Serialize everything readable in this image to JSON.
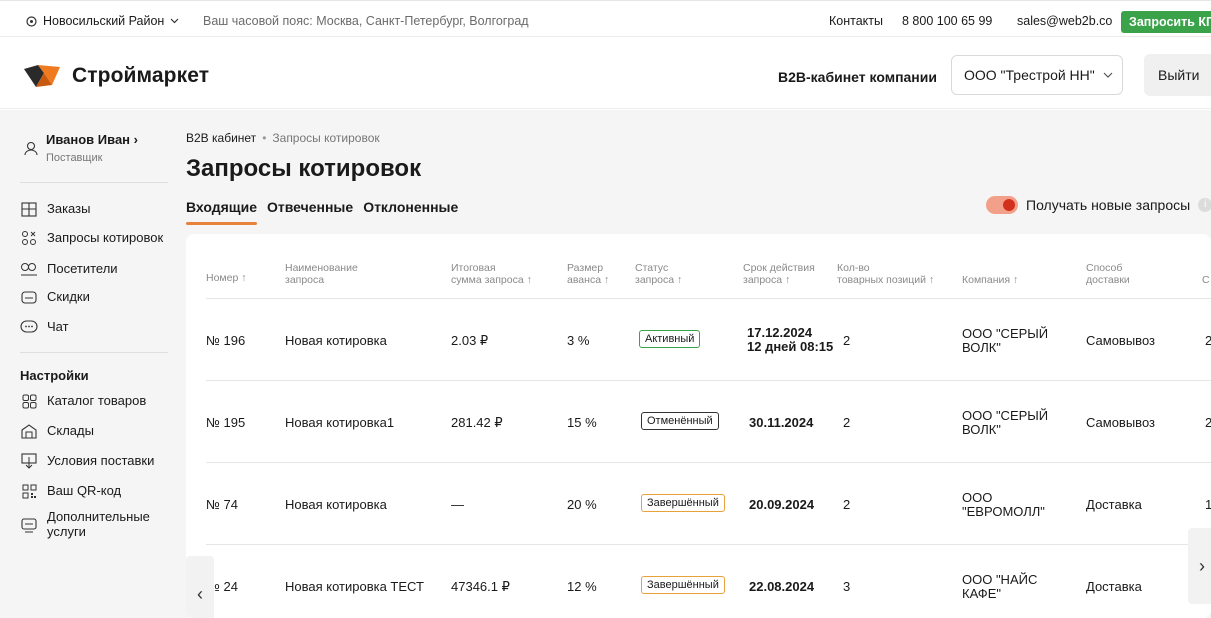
{
  "topbar": {
    "region": "Новосильский Район",
    "timezone": "Ваш часовой пояс: Москва, Санкт-Петербург, Волгоград",
    "contacts": "Контакты",
    "phone": "8 800 100 65 99",
    "email": "sales@web2b.co",
    "request_kp": "Запросить КП"
  },
  "header": {
    "brand": "Строймаркет",
    "b2b_label": "B2B-кабинет компании",
    "company": "ООО \"Трестрой НН\"",
    "logout": "Выйти"
  },
  "sidebar": {
    "user_name": "Иванов Иван ›",
    "user_role": "Поставщик",
    "items": [
      {
        "label": "Заказы",
        "icon": "orders-icon"
      },
      {
        "label": "Запросы котировок",
        "icon": "quotes-icon"
      },
      {
        "label": "Посетители",
        "icon": "visitors-icon"
      },
      {
        "label": "Скидки",
        "icon": "discount-icon"
      },
      {
        "label": "Чат",
        "icon": "chat-icon"
      }
    ],
    "settings_title": "Настройки",
    "settings_items": [
      {
        "label": "Каталог товаров",
        "icon": "catalog-icon"
      },
      {
        "label": "Склады",
        "icon": "warehouse-icon"
      },
      {
        "label": "Условия поставки",
        "icon": "delivery-terms-icon"
      },
      {
        "label": "Ваш QR-код",
        "icon": "qr-code-icon"
      },
      {
        "label": "Дополнительные",
        "label2": "услуги",
        "icon": "services-icon"
      }
    ]
  },
  "main": {
    "breadcrumb": {
      "root": "B2B кабинет",
      "sep": "•",
      "current": "Запросы котировок"
    },
    "title": "Запросы котировок",
    "tabs": [
      "Входящие",
      "Отвеченные",
      "Отклоненные"
    ],
    "active_tab": "Входящие",
    "toggle_label": "Получать новые запросы",
    "toggle_on": true,
    "columns": [
      {
        "l1": "Номер ↑",
        "l2": ""
      },
      {
        "l1": "Наименование",
        "l2": "запроса"
      },
      {
        "l1": "Итоговая",
        "l2": "сумма запроса ↑"
      },
      {
        "l1": "Размер",
        "l2": "аванса ↑"
      },
      {
        "l1": "Статус",
        "l2": "запроса ↑"
      },
      {
        "l1": "Срок действия",
        "l2": "запроса ↑"
      },
      {
        "l1": "Кол-во",
        "l2": "товарных позиций ↑"
      },
      {
        "l1": "Компания ↑",
        "l2": ""
      },
      {
        "l1": "Способ",
        "l2": "доставки"
      },
      {
        "l1": "С",
        "l2": ""
      }
    ],
    "rows": [
      {
        "num": "№ 196",
        "name": "Новая котировка",
        "sum": "2.03 ₽",
        "advance": "3 %",
        "status": "Активный",
        "status_kind": "active",
        "date": "17.12.2024",
        "date2": "12 дней 08:15",
        "qty": "2",
        "company": "ООО \"СЕРЫЙ",
        "company2": "ВОЛК\"",
        "delivery": "Самовывоз",
        "extra": "2"
      },
      {
        "num": "№ 195",
        "name": "Новая котировка1",
        "sum": "281.42 ₽",
        "advance": "15 %",
        "status": "Отменённый",
        "status_kind": "cancel",
        "date": "30.11.2024",
        "date2": "",
        "qty": "2",
        "company": "ООО \"СЕРЫЙ",
        "company2": "ВОЛК\"",
        "delivery": "Самовывоз",
        "extra": "2"
      },
      {
        "num": "№ 74",
        "name": "Новая котировка",
        "sum": "—",
        "advance": "20 %",
        "status": "Завершённый",
        "status_kind": "done",
        "date": "20.09.2024",
        "date2": "",
        "qty": "2",
        "company": "ООО",
        "company2": "\"ЕВРОМОЛЛ\"",
        "delivery": "Доставка",
        "extra": "1"
      },
      {
        "num": "№ 24",
        "name": "Новая котировка ТЕСТ",
        "sum": "47346.1 ₽",
        "advance": "12 %",
        "status": "Завершённый",
        "status_kind": "done",
        "date": "22.08.2024",
        "date2": "",
        "qty": "3",
        "company": "ООО \"НАЙС",
        "company2": "КАФЕ\"",
        "delivery": "Доставка",
        "extra": "1"
      }
    ],
    "prev_arrow": "‹",
    "next_arrow": "›"
  },
  "colors": {
    "accent": "#e8813c",
    "green": "#3aa34a",
    "toggle": "#d2301c"
  }
}
